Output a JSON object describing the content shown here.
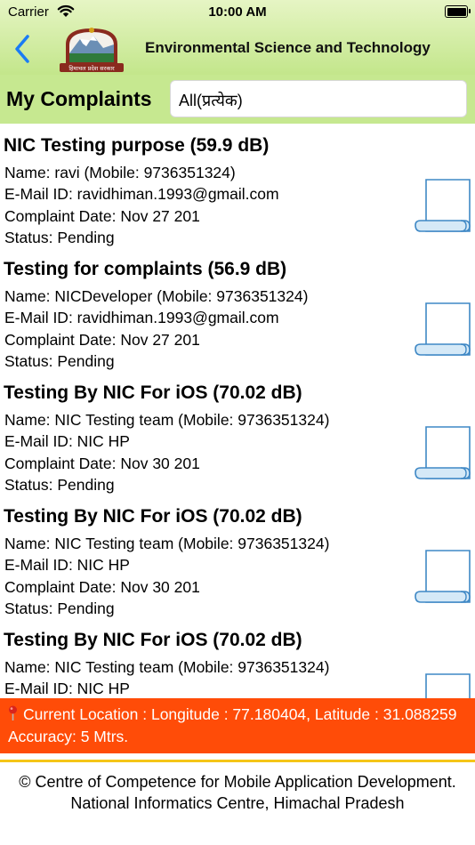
{
  "status_bar": {
    "carrier": "Carrier",
    "time": "10:00 AM"
  },
  "nav": {
    "title": "Environmental Science and Technology",
    "emblem_text": "हिमाचल प्रदेश सरकार"
  },
  "complaints_header": {
    "title": "My Complaints",
    "filter_value": "All(प्रत्येक)"
  },
  "complaints": [
    {
      "title": "NIC Testing purpose (59.9 dB)",
      "name": "Name: ravi (Mobile: 9736351324)",
      "email": "E-Mail ID: ravidhiman.1993@gmail.com",
      "date": "Complaint Date: Nov 27 201",
      "status": "Status: Pending"
    },
    {
      "title": "Testing for complaints (56.9 dB)",
      "name": "Name: NICDeveloper (Mobile: 9736351324)",
      "email": "E-Mail ID: ravidhiman.1993@gmail.com",
      "date": "Complaint Date: Nov 27 201",
      "status": "Status: Pending"
    },
    {
      "title": "Testing By NIC For iOS (70.02 dB)",
      "name": "Name: NIC Testing team (Mobile: 9736351324)",
      "email": "E-Mail ID: NIC HP",
      "date": "Complaint Date: Nov 30 201",
      "status": "Status: Pending"
    },
    {
      "title": "Testing By NIC For iOS (70.02 dB)",
      "name": "Name: NIC Testing team (Mobile: 9736351324)",
      "email": "E-Mail ID: NIC HP",
      "date": "Complaint Date: Nov 30 201",
      "status": "Status: Pending"
    },
    {
      "title": "Testing By NIC For iOS (70.02 dB)",
      "name": "Name: NIC Testing team (Mobile: 9736351324)",
      "email": "E-Mail ID: NIC HP",
      "date": "",
      "status": ""
    }
  ],
  "location_bar": {
    "icon": "pin-icon",
    "text": "Current Location : Longitude : 77.180404, Latitude : 31.088259 Accuracy: 5 Mtrs."
  },
  "footer": {
    "text": "© Centre of Competence for Mobile Application Development. National Informatics Centre, Himachal Pradesh"
  },
  "colors": {
    "header_green": "#c6e890",
    "back_blue": "#1a7cf5",
    "location_orange": "#ff4c08",
    "footer_rule": "#f5c518",
    "doc_icon": "#3f88c5"
  }
}
